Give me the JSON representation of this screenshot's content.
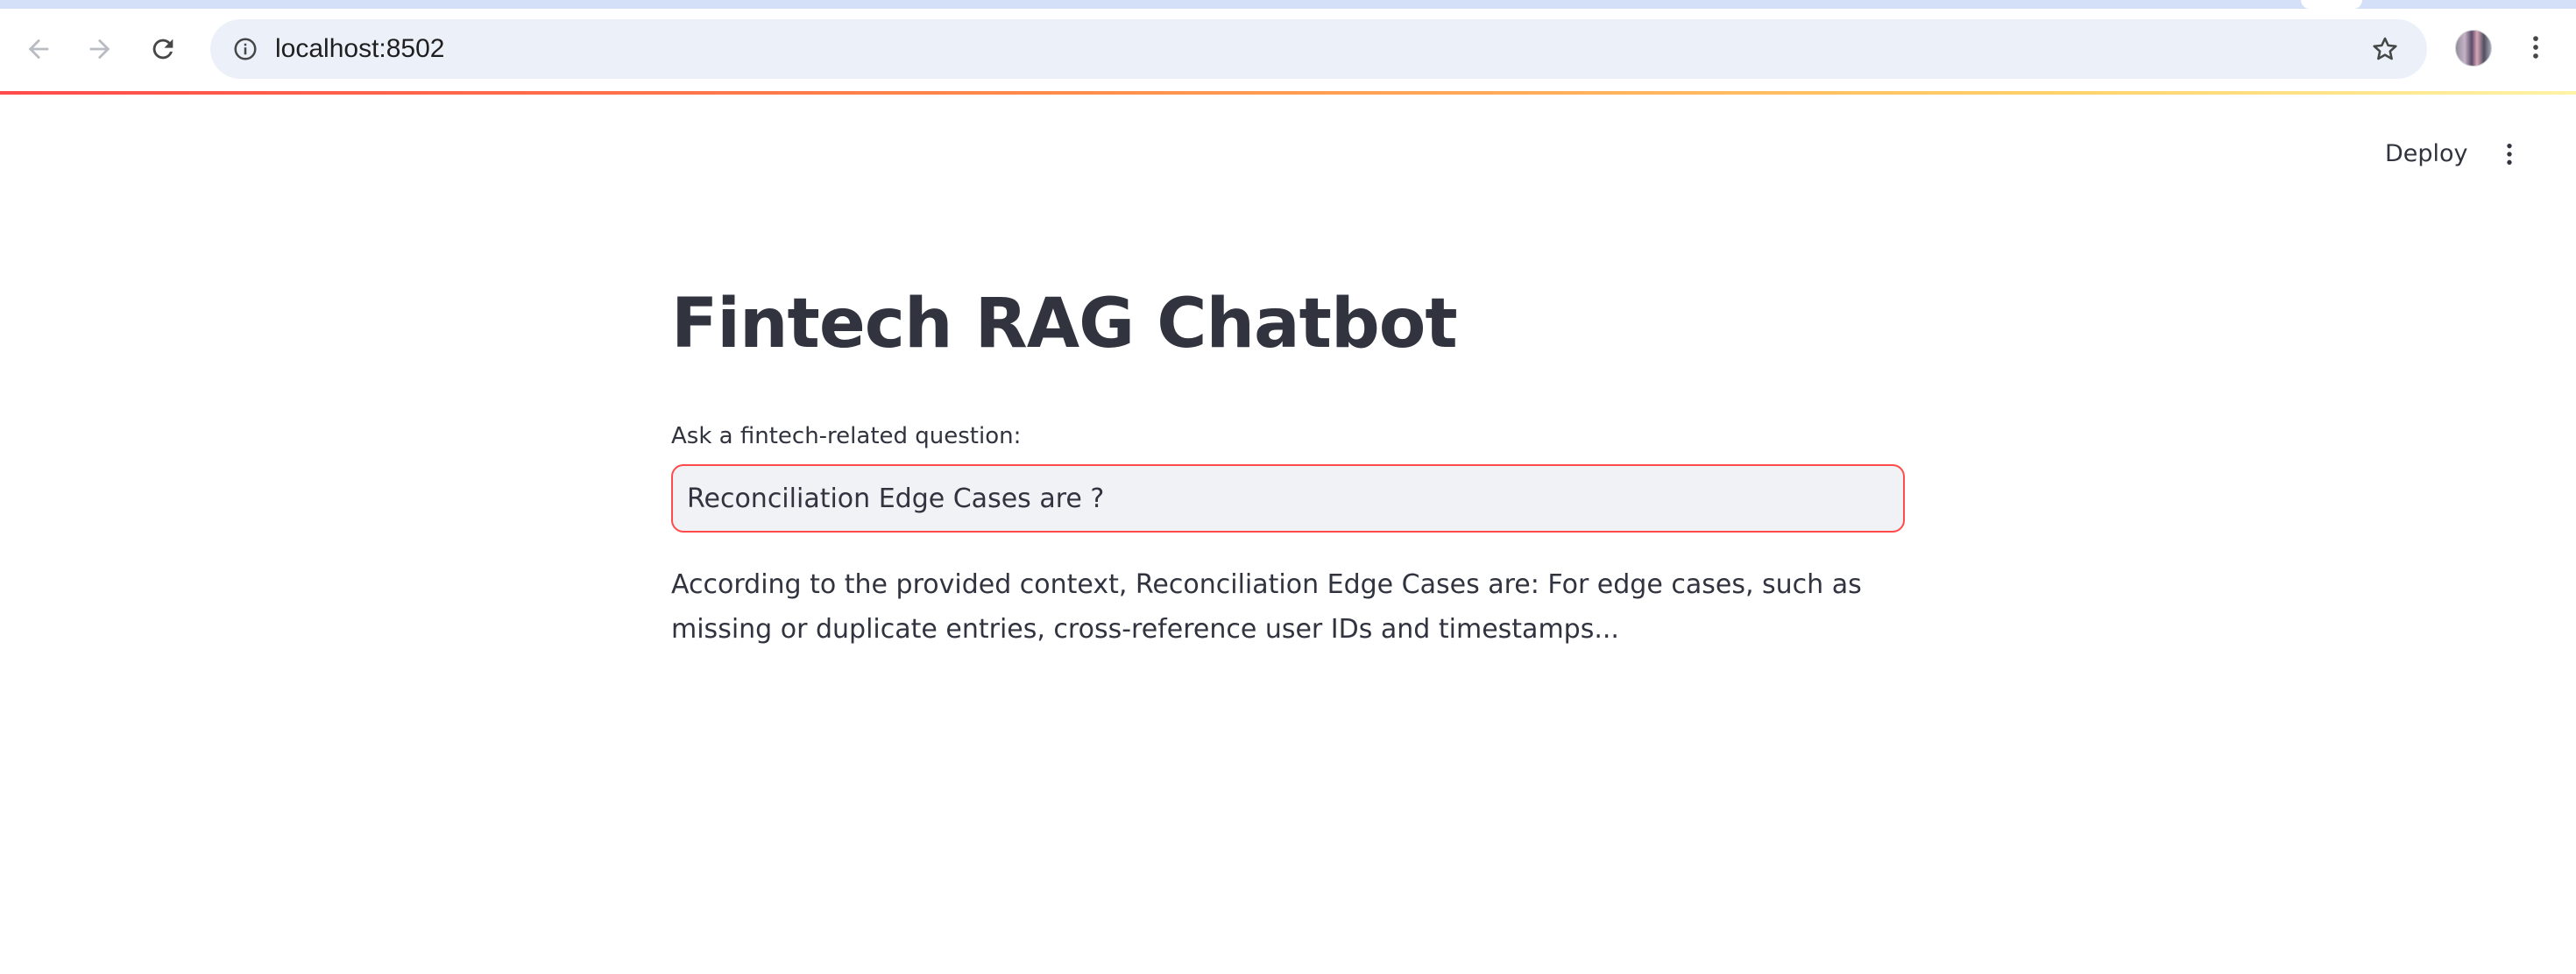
{
  "browser": {
    "url": "localhost:8502",
    "icons": {
      "back": "back-arrow-icon",
      "forward": "forward-arrow-icon",
      "reload": "reload-icon",
      "site_info": "info-icon",
      "bookmark": "star-icon",
      "profile": "avatar",
      "menu": "vertical-dots-icon"
    }
  },
  "header": {
    "deploy_label": "Deploy",
    "menu_icon": "vertical-dots-icon"
  },
  "theme": {
    "accent": "#ff4b4b",
    "text": "#31333f",
    "input_bg": "#f0f2f6",
    "omnibox_bg": "#ecf1f9"
  },
  "main": {
    "title": "Fintech RAG Chatbot",
    "input_label": "Ask a fintech-related question:",
    "input_value": "Reconciliation Edge Cases are ?",
    "answer": "According to the provided context, Reconciliation Edge Cases are: For edge cases, such as missing or duplicate entries, cross-reference user IDs and timestamps..."
  }
}
